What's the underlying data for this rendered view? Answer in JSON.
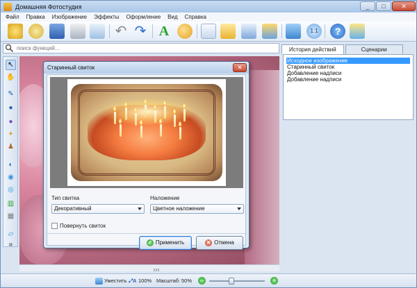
{
  "window": {
    "title": "Домашняя Фотостудия"
  },
  "menu": [
    "Файл",
    "Правка",
    "Изображение",
    "Эффекты",
    "Оформление",
    "Вид",
    "Справка"
  ],
  "search": {
    "placeholder": "поиск функций..."
  },
  "panel": {
    "tabs": [
      "История действий",
      "Сценарии"
    ],
    "history": [
      "Исходное изображение",
      "Старинный свиток",
      "Добавление надписи",
      "Добавление надписи"
    ]
  },
  "status": {
    "fit_label": "Уместить",
    "zoom100_label": "100%",
    "scale_label": "Масштаб:",
    "scale_value": "50%",
    "zoom_percent": 50
  },
  "dialog": {
    "title": "Старинный свиток",
    "scroll_type_label": "Тип свитка",
    "scroll_type_value": "Декоративный",
    "overlay_label": "Наложение",
    "overlay_value": "Цветное наложение",
    "rotate_label": "Повернуть свиток",
    "apply_label": "Применить",
    "cancel_label": "Отмена"
  },
  "colors": {
    "accent": "#3399ff",
    "title_bar": "#b6cdea",
    "apply_icon": "#2e9a2e",
    "cancel_icon": "#c94a32"
  }
}
